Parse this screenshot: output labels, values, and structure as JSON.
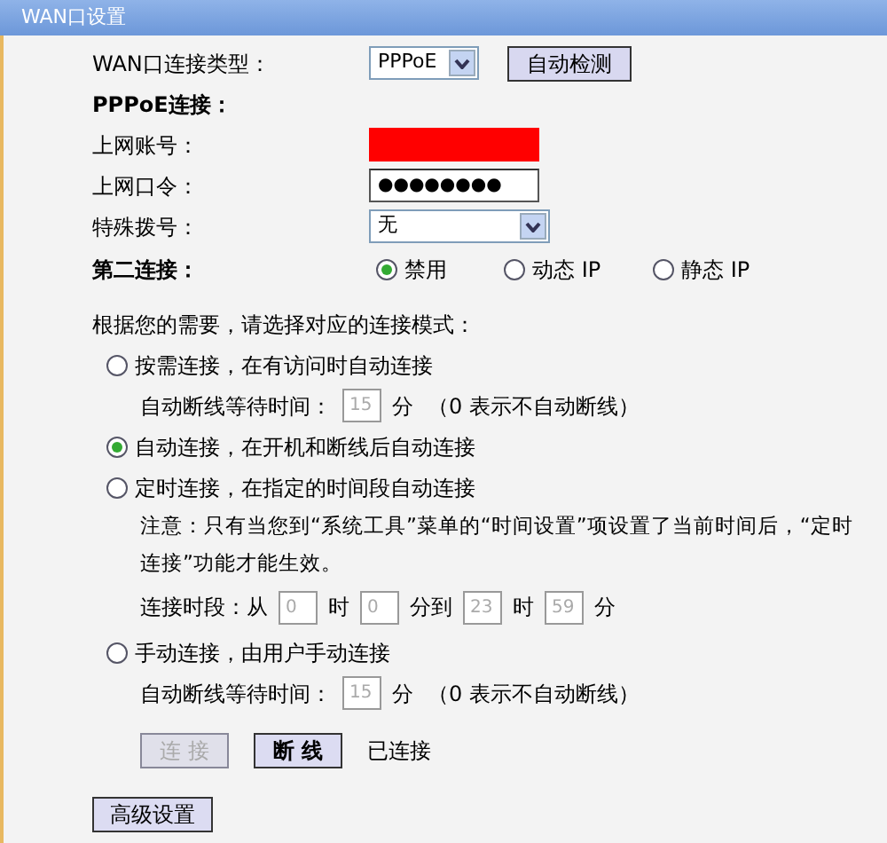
{
  "window": {
    "title": "WAN口设置"
  },
  "connection_type": {
    "label": "WAN口连接类型：",
    "value": "PPPoE",
    "button": "自动检测"
  },
  "pppoe": {
    "heading": "PPPoE连接：",
    "account": {
      "label": "上网账号：",
      "redacted": true
    },
    "password": {
      "label": "上网口令：",
      "value": "●●●●●●●●"
    },
    "dial": {
      "label": "特殊拨号：",
      "value": "无"
    }
  },
  "second_connection": {
    "label": "第二连接：",
    "options": [
      {
        "label": "禁用",
        "selected": true
      },
      {
        "label": "动态 IP",
        "selected": false
      },
      {
        "label": "静态 IP",
        "selected": false
      }
    ]
  },
  "modes_prompt": "根据您的需要，请选择对应的连接模式：",
  "modes": [
    {
      "label": "按需连接，在有访问时自动连接",
      "selected": false,
      "details": [
        {
          "kind": "timeout",
          "label": "自动断线等待时间：",
          "value": "15",
          "unit": "分",
          "note": "（0 表示不自动断线）",
          "disabled": true
        }
      ]
    },
    {
      "label": "自动连接，在开机和断线后自动连接",
      "selected": true
    },
    {
      "label": "定时连接，在指定的时间段自动连接",
      "selected": false,
      "details": [
        {
          "kind": "note",
          "text": "注意：只有当您到“系统工具”菜单的“时间设置”项设置了当前时间后，“定时连接”功能才能生效。"
        },
        {
          "kind": "schedule",
          "parts": [
            {
              "kind": "text",
              "text": "连接时段：从"
            },
            {
              "kind": "field",
              "value": "0",
              "disabled": true
            },
            {
              "kind": "text",
              "text": "时"
            },
            {
              "kind": "field",
              "value": "0",
              "disabled": true
            },
            {
              "kind": "text",
              "text": "分到"
            },
            {
              "kind": "field",
              "value": "23",
              "disabled": true
            },
            {
              "kind": "text",
              "text": "时"
            },
            {
              "kind": "field",
              "value": "59",
              "disabled": true
            },
            {
              "kind": "text",
              "text": "分"
            }
          ]
        }
      ]
    },
    {
      "label": "手动连接，由用户手动连接",
      "selected": false,
      "details": [
        {
          "kind": "timeout",
          "label": "自动断线等待时间：",
          "value": "15",
          "unit": "分",
          "note": "（0 表示不自动断线）",
          "disabled": true
        }
      ]
    }
  ],
  "actions": [
    {
      "label": "连 接",
      "disabled": true
    },
    {
      "label": "断 线",
      "disabled": false
    }
  ],
  "status": "已连接",
  "advanced_button": "高级设置"
}
